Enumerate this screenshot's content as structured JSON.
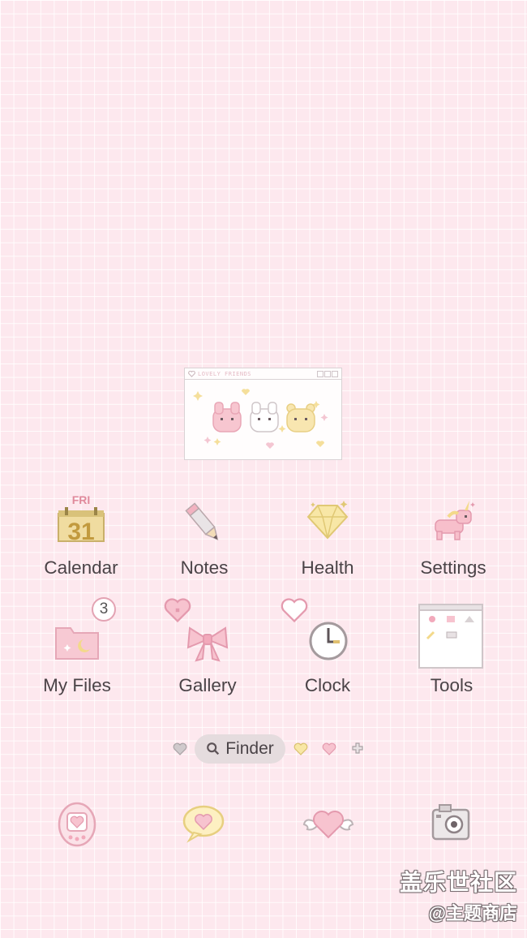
{
  "widget": {
    "title": "LOVELY FRIENDS"
  },
  "apps": [
    {
      "label": "Calendar",
      "icon": "calendar-icon",
      "day": "FRI",
      "date": "31"
    },
    {
      "label": "Notes",
      "icon": "pencil-icon"
    },
    {
      "label": "Health",
      "icon": "diamond-icon"
    },
    {
      "label": "Settings",
      "icon": "unicorn-icon"
    },
    {
      "label": "My Files",
      "icon": "folder-icon",
      "badge": "3"
    },
    {
      "label": "Gallery",
      "icon": "bow-icon"
    },
    {
      "label": "Clock",
      "icon": "clock-icon"
    },
    {
      "label": "Tools",
      "icon": "tools-window-icon"
    }
  ],
  "finder": {
    "label": "Finder"
  },
  "dock": [
    {
      "icon": "egg-device-icon"
    },
    {
      "icon": "heart-bubble-icon"
    },
    {
      "icon": "winged-heart-icon"
    },
    {
      "icon": "camera-icon"
    }
  ],
  "watermark": {
    "line1": "盖乐世社区",
    "line2": "@主题商店"
  },
  "colors": {
    "background": "#fde8ee",
    "grid": "#ffffff",
    "accent_pink": "#f2b6c4",
    "text": "#4a4347"
  }
}
